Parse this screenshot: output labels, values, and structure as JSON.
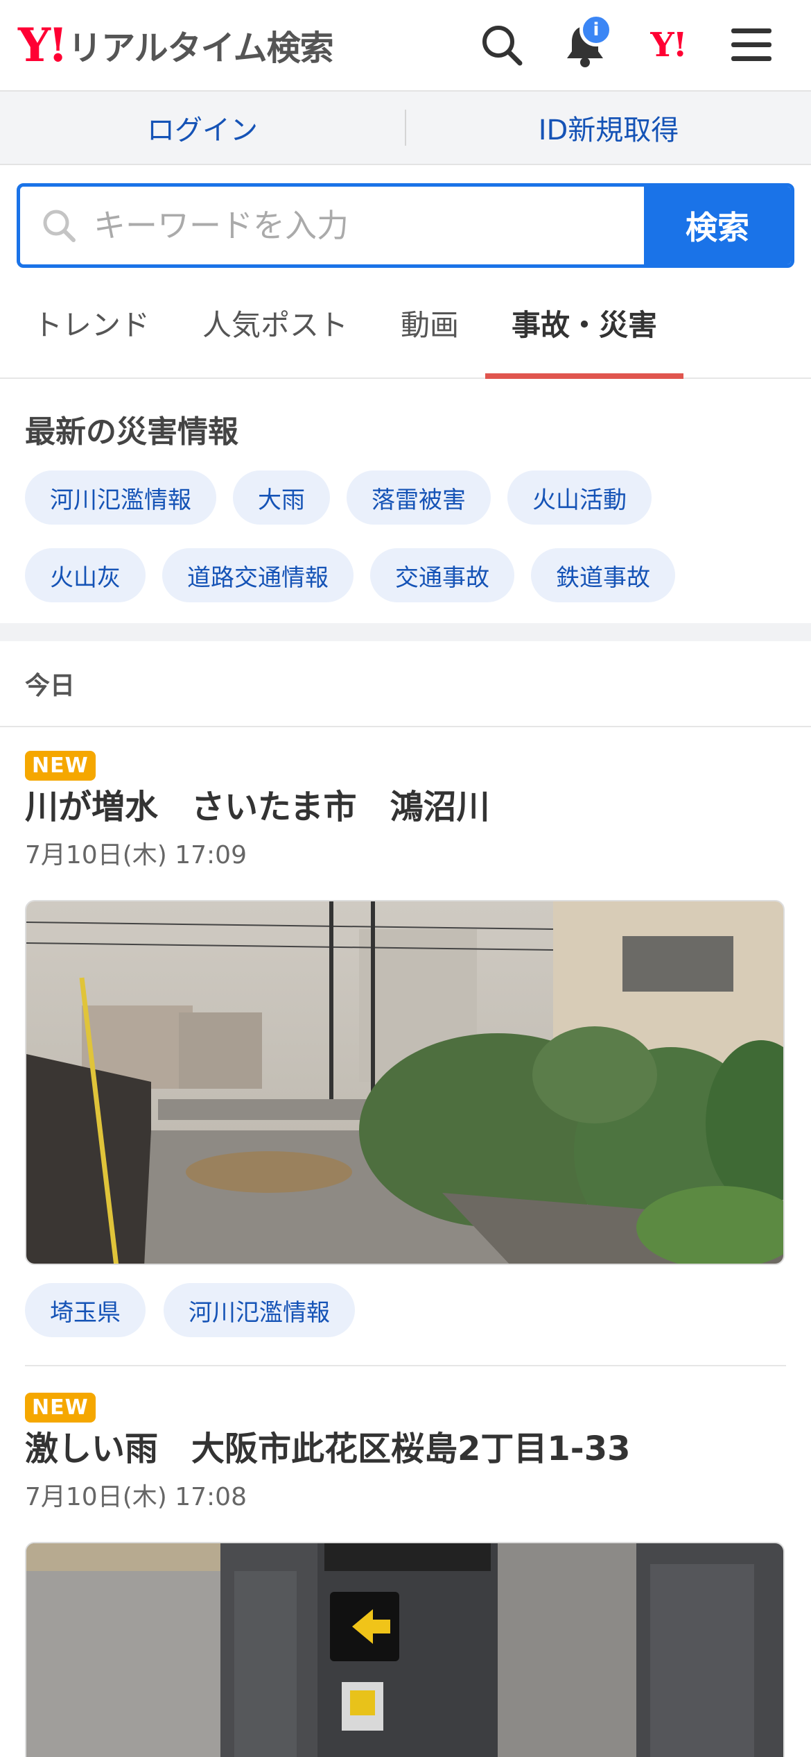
{
  "header": {
    "logo_text": "Y!",
    "app_title": "リアルタイム検索",
    "notification_badge": "i",
    "yahoo_mark": "Y!"
  },
  "login_bar": {
    "login": "ログイン",
    "register": "ID新規取得"
  },
  "search": {
    "placeholder": "キーワードを入力",
    "button": "検索"
  },
  "tabs": [
    {
      "label": "トレンド",
      "active": false
    },
    {
      "label": "人気ポスト",
      "active": false
    },
    {
      "label": "動画",
      "active": false
    },
    {
      "label": "事故・災害",
      "active": true
    }
  ],
  "disaster_section": {
    "title": "最新の災害情報",
    "chips": [
      "河川氾濫情報",
      "大雨",
      "落雷被害",
      "火山活動",
      "火山灰",
      "道路交通情報",
      "交通事故",
      "鉄道事故"
    ]
  },
  "day_heading": "今日",
  "posts": [
    {
      "badge": "NEW",
      "title": "川が増水　さいたま市　鴻沼川",
      "time": "7月10日(木) 17:09",
      "tags": [
        "埼玉県",
        "河川氾濫情報"
      ]
    },
    {
      "badge": "NEW",
      "title": "激しい雨　大阪市此花区桜島2丁目1-33",
      "time": "7月10日(木) 17:08"
    }
  ],
  "colors": {
    "brand_red": "#ff0033",
    "link_blue": "#1553b6",
    "search_blue": "#1a73e8",
    "tab_active_underline": "#e0554e",
    "new_badge": "#f5a700",
    "chip_bg": "#eaf0fb"
  }
}
